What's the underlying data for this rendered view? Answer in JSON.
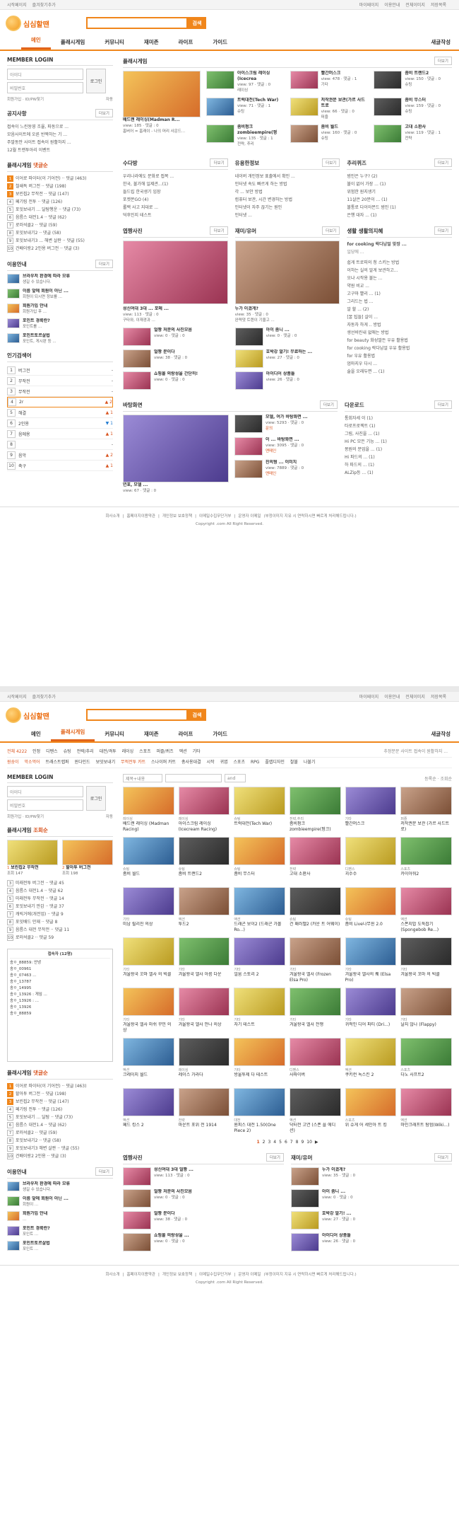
{
  "common": {
    "topbar_left": [
      "시작페이지",
      "즐겨찾기추가"
    ],
    "topbar_right": [
      "마이페이지",
      "이용안내",
      "전체이미지",
      "저장목록"
    ],
    "logo": "심심할땐",
    "search_btn": "검색",
    "gnb_right": "새글작성",
    "login_title": "MEMBER LOGIN",
    "id_placeholder": "아이디",
    "pw_placeholder": "비밀번호",
    "login_btn": "로그인",
    "signup": "회원가입 · ID/PW찾기",
    "auto": "자동",
    "more": "더보기",
    "footer_links": [
      "회사소개",
      "홈페이지이용약관",
      "개인정보 보호정책",
      "이메일수집무단거부",
      "운영자 이메일"
    ],
    "footer_note": "(부정이미지 지유 시 연락하시면 빠르게 처리해드립니다.)",
    "copyright": "Copyright .com All Right Reserved."
  },
  "shotA": {
    "gnb": [
      "메인",
      "플래시게임",
      "커뮤니티",
      "재미존",
      "라이프",
      "가이드"
    ],
    "notice_title": "공지사항",
    "notices": [
      "접속이 느린동영 조율, 파동으로 ...",
      "모음사이트에 오른 반짝하는 기 ...",
      "주말동안 사이트 접속이 원활하지 ...",
      "12월 트랜투아리 이벤트"
    ],
    "flash_list_title": "플래시게임",
    "flash_list_sub": "댓글순",
    "flash_list": [
      {
        "n": "1",
        "t": "이어로 파이터(이 기어전) ·· 댓글 (463)"
      },
      {
        "n": "2",
        "t": "철쇄독 버그전 ·· 댓글 (198)"
      },
      {
        "n": "3",
        "t": "보린칩2 무작전 ·· 댓글 (147)"
      },
      {
        "n": "4",
        "t": "페기링 전투 ·· 댓글 (126)"
      },
      {
        "n": "5",
        "t": "포잇보내기 ... 달탐행운 ·· 댓글 (73)"
      },
      {
        "n": "6",
        "t": "음름스 대전1.4 ·· 댓글 (62)"
      },
      {
        "n": "7",
        "t": "로러석클2 ·· 댓글 (59)"
      },
      {
        "n": "8",
        "t": "포잇보내기2 ·· 댓글 (58)"
      },
      {
        "n": "9",
        "t": "포잇보내기3 ... 해변 살판 ·· 댓글 (55)"
      },
      {
        "n": "10",
        "t": "건배이랑2 2인용 버그전 ·· 댓글 (3)"
      }
    ],
    "guide_title": "이용안내",
    "guides": [
      {
        "t": "브라우저 환경에 따라 모류",
        "s": "생길 수 있습니다."
      },
      {
        "t": "이름 앞에 회원이 아닌 ...",
        "s": "회원이 되시면 정보를 ..."
      },
      {
        "t": "회원가입 안내",
        "s": "회원가입 후 ..."
      },
      {
        "t": "포인트 경륙란?",
        "s": "포인트를 ..."
      },
      {
        "t": "포인트토르살법",
        "s": "포인트, 게시판 등 ..."
      }
    ],
    "ranking_title": "인기검색어",
    "ranking": [
      {
        "n": "1",
        "k": "버그전",
        "c": "-",
        "cls": ""
      },
      {
        "n": "2",
        "k": "무작전",
        "c": "-",
        "cls": ""
      },
      {
        "n": "3",
        "k": "무작전",
        "c": "-",
        "cls": ""
      },
      {
        "n": "4",
        "k": "2r",
        "c": "▲ 2",
        "cls": "up"
      },
      {
        "n": "5",
        "k": "해결",
        "c": "▲ 1",
        "cls": "up"
      },
      {
        "n": "6",
        "k": "2인용",
        "c": "▼ 1",
        "cls": "dn"
      },
      {
        "n": "7",
        "k": "음에용",
        "c": "▲ 1",
        "cls": "up"
      },
      {
        "n": "8",
        "k": "",
        "c": "-",
        "cls": ""
      },
      {
        "n": "9",
        "k": "음악",
        "c": "▲ 2",
        "cls": "up"
      },
      {
        "n": "10",
        "k": "축구",
        "c": "▲ 1",
        "cls": "up"
      }
    ],
    "flash_title": "플래시게임",
    "games": [
      {
        "t": "배드랜 레이싱(Madman R...",
        "v": "view: 185 · 댓글 : 0",
        "d": "홈버어 = 홈래이 - 나의 머리 사운드..."
      },
      {
        "t": "아이스크림 레이싱 (Icecrea",
        "v": "view: 97 · 댓글 : 0",
        "d": "레이싱"
      },
      {
        "t": "빨간머스크",
        "v": "view: 478 · 댓글 : 1",
        "d": "기타"
      },
      {
        "t": "좀비 트랜드2",
        "v": "view: 150 · 댓글 : 0",
        "d": "슈팅"
      },
      {
        "t": "트럭대전(Tech War)",
        "v": "view: 71 · 댓글 : 1",
        "d": "슈팅"
      },
      {
        "t": "저작권문 보관(가르 사드트로",
        "v": "view: 66 · 댓글 : 0",
        "d": "퍼즐"
      },
      {
        "t": "좀비 무스터",
        "v": "view: 159 · 댓글 : 0",
        "d": "슈팅"
      },
      {
        "t": "좀비펑크 zombieempire(펑",
        "v": "view: 135 · 댓글 : 1",
        "d": "전략, 추리"
      },
      {
        "t": "좀비 월드",
        "v": "view: 160 · 댓글 : 0",
        "d": "슈팅"
      },
      {
        "t": "고대 소환사",
        "v": "view: 119 · 댓글 : 1",
        "d": "전략"
      }
    ],
    "c1_title": "수다방",
    "c1": [
      {
        "t": "우리나라에도 문화로 접목 ..."
      },
      {
        "t": "한국, 불가해 일제관...(1)"
      },
      {
        "t": "들드립 한국생기 입장"
      },
      {
        "t": "포켓몬GO (4)"
      },
      {
        "t": "롤백 사고 지대로 ..."
      },
      {
        "t": "덕후인지 테스트"
      }
    ],
    "c2_title": "유용한정보",
    "c2": [
      {
        "t": "네이버 개인정보 표출에서 확인 ..."
      },
      {
        "t": "인터넷 속도 빠르게 하는 방법"
      },
      {
        "t": "각 ... 보안 방법"
      },
      {
        "t": "컴퓨터 보관, 시간 변경하는 방법"
      },
      {
        "t": "인터넷이 자주 끊기는 원인"
      },
      {
        "t": "인터넷 ..."
      }
    ],
    "c3_title": "추리퀴즈",
    "c3": [
      {
        "t": "범인은 누구? (2)"
      },
      {
        "t": "불이 없어 가장 ... (1)"
      },
      {
        "t": "위험한 원지생기"
      },
      {
        "t": "11살은 20분이 ... (1)"
      },
      {
        "t": "볼통로 다이아몬드 범인 (1)"
      },
      {
        "t": "은행 대자 ... (1)"
      }
    ],
    "p1_title": "엽짱사진",
    "p1_main": {
      "t": "성신여대 3대 ... 포메 ...",
      "v": "view: 113 · 댓글 : 0",
      "d": "구타와, 이재경과 ..."
    },
    "p1": [
      {
        "t": "얼짱 처분의 사진모음",
        "v": "view: 0 · 댓글 : 0"
      },
      {
        "t": "얼짱 분이다",
        "v": "view: 38 · 댓글 : 0"
      },
      {
        "t": "쇼핑몰 의랑성을 간단히!",
        "v": "view: 0 · 댓글 : 0"
      }
    ],
    "p2_title": "재미/유머",
    "p2_main": {
      "t": "누가 이겼게?",
      "v": "view: 35 · 댓글 : 0",
      "d": "완력댓 트렌이 기울고 ..."
    },
    "p2": [
      {
        "t": "아이 좀니 ...",
        "v": "view: 0 · 댓글 : 0"
      },
      {
        "t": "호박강 알기! 무료하는 ...",
        "v": "view: 27 · 댓글 : 0"
      },
      {
        "t": "아이디어 상품들",
        "v": "view: 26 · 댓글 : 0"
      }
    ],
    "p3_title": "생활 생활의지혜",
    "p3_lead": "for cooking 락다납얼 맞장 ...",
    "p3_desc": "일당에 ...",
    "p3": [
      "쉽게 트로피의 청 스키는 방법",
      "이하는 실의 알게 보관하고...",
      "오냐 시작용 불는 ...",
      "약원 비교 ...",
      "고구마 빨리 ... (1)",
      "그리드는 법 ...",
      "알 할 ... (2)",
      "[꿀 팁들] 살이 ...",
      "자동차 하게 .. 방법",
      "생선비린내 없애는 방법",
      "for beauty 화성말든 우유 활용법",
      "for cooking 락다납얼 우유 활용법",
      "for 우유 활용법",
      "엄마지우 다시 ...",
      "술을 오래두면 ... (1)"
    ],
    "v_title": "바탕화면",
    "v_main": {
      "t": "연표, 모델 ...",
      "v": "view: 67 · 댓글 : 0"
    },
    "v": [
      {
        "t": "모델, 여가 바탕화면 ...",
        "v": "view: 5293 · 댓글 : 0",
        "a": "문의"
      },
      {
        "t": "이 ... 바탕화면 ...",
        "v": "view: 3095 · 댓글 : 0",
        "a": "맨메인"
      },
      {
        "t": "친의형 ... 이미지",
        "v": "view: 7889 · 댓글 : 0",
        "a": "맨메인"
      }
    ],
    "dl_title": "다운로드",
    "dl": [
      "통회자세 이 (1)",
      "타로프로젝트 (1)",
      "그림, 사진을 ... (1)",
      "Hi PC 모든 기능 ... (1)",
      "몽원의 분업을 ... (1)",
      "Hi 파드의 ... (1)",
      "하 파드의 ... (1)",
      "ALZip등 ... (1)"
    ]
  },
  "shotB": {
    "gnb": [
      "메인",
      "플래시게임",
      "커뮤니티",
      "재미존",
      "라이프",
      "가이드"
    ],
    "cat_all": "전체 4222",
    "cats1": [
      "인정",
      "디펜스",
      "슈팅",
      "전략/추리",
      "대전/격투",
      "레이싱",
      "스포츠",
      "퍼즐/퀴즈",
      "액션",
      "기타"
    ],
    "cat_hint": "추정분문 사이트 접속이 원활하지 ...",
    "cats2": [
      "원숭이",
      "막소먹어",
      "트래스트랩퍼",
      "윈다인드",
      "보잇보내기",
      "무적전투 카트",
      "스나이퍼 카트",
      "총사용대결",
      "시작",
      "귀엽",
      "스포츠",
      "RPG",
      "플랩디자인",
      "찰불",
      "나불기"
    ],
    "filter_sel": "제목+내용",
    "filter_btn": "and",
    "filter_right": "등록순 · 조회순",
    "ranked_title": "플래시게임",
    "ranked_sub": "조회순",
    "ranked_top": [
      {
        "n": "1",
        "t": "보린칩2 무작전",
        "c": "조회 147"
      },
      {
        "n": "2",
        "t": "할아투 버그전",
        "c": "조회 198"
      }
    ],
    "ranked_list": [
      {
        "n": "3",
        "t": "미래전투 버그전 ·· 댓글 45"
      },
      {
        "n": "4",
        "t": "음름스 대전1.4 ·· 댓글 62"
      },
      {
        "n": "5",
        "t": "미래전투 무작전 ·· 댓글 14"
      },
      {
        "n": "6",
        "t": "포잇보내기 만감 ·· 댓글 37"
      },
      {
        "n": "7",
        "t": "캐릭거에(개전업) ·· 댓글 9"
      },
      {
        "n": "8",
        "t": "포잇배드 만재 ·· 댓글 8"
      },
      {
        "n": "9",
        "t": "음름스 대전 무작전 ·· 댓글 11"
      },
      {
        "n": "10",
        "t": "로러석클2 ·· 댓글 59"
      }
    ],
    "chat_title": "접속자 (12명)",
    "chat": [
      "송ㅇ_88859: 안녕",
      "송ㅇ_00961",
      "송ㅇ_07463 ...",
      "송ㅇ_13787",
      "송ㅇ_14995",
      "송ㅇ_13926 : 게임 ...",
      "송ㅇ_13926 : ...",
      "송ㅇ_13926",
      "송ㅇ_88859"
    ],
    "list2_title": "플래시게임",
    "list2_sub": "댓글순",
    "list2": [
      {
        "n": "1",
        "t": "이어로 파이터(이 기어전) ·· 댓글 (463)"
      },
      {
        "n": "2",
        "t": "할아투 버그전 ·· 댓글 (198)"
      },
      {
        "n": "3",
        "t": "보린칩2 무작전 ·· 댓글 (147)"
      },
      {
        "n": "4",
        "t": "페기링 전투 ·· 댓글 (126)"
      },
      {
        "n": "5",
        "t": "포잇보내기 ... 달탐 ·· 댓글 (73)"
      },
      {
        "n": "6",
        "t": "음름스 대전1.4 ·· 댓글 (62)"
      },
      {
        "n": "7",
        "t": "로러석클2 ·· 댓글 (59)"
      },
      {
        "n": "8",
        "t": "포잇보내기2 ·· 댓글 (58)"
      },
      {
        "n": "9",
        "t": "포잇보내기3 해변 살판 ·· 댓글 (55)"
      },
      {
        "n": "10",
        "t": "건배이랑2 2인용 ·· 댓글 (3)"
      }
    ],
    "guide_title": "이용안내",
    "guides": [
      {
        "t": "브라우저 환경에 따라 모류",
        "s": "생길 수 있습니다."
      },
      {
        "t": "이름 앞에 회원이 아닌 ...",
        "s": "회원이 ..."
      },
      {
        "t": "회원가입 안내",
        "s": "..."
      },
      {
        "t": "포인트 경륙란?",
        "s": "포인트 ..."
      },
      {
        "t": "포인트토르살법",
        "s": "포인트 ..."
      }
    ],
    "cells": [
      {
        "n": "배드랜 레이싱 (Madman Racing)",
        "k": "레이싱"
      },
      {
        "n": "아이스크림 레이싱 (Icecream Racing)",
        "k": "레이싱"
      },
      {
        "n": "트럭대전(Tech War)",
        "k": "슈팅"
      },
      {
        "n": "좀비펑크 zombieempire(펑크)",
        "k": "전략,추리"
      },
      {
        "n": "빨간머스크",
        "k": "기타"
      },
      {
        "n": "저작권문 보관 (가르 사드트로)",
        "k": "퍼즐"
      },
      {
        "n": "좀비 월드",
        "k": "슈팅"
      },
      {
        "n": "좀비 트랜드2",
        "k": "슈팅"
      },
      {
        "n": "좀비 무스터",
        "k": "슈팅"
      },
      {
        "n": "고대 소환사",
        "k": "전략"
      },
      {
        "n": "괴수수",
        "k": "디펜스"
      },
      {
        "n": "카이아워2",
        "k": "스포츠"
      },
      {
        "n": "미남 릴리진 의상",
        "k": "기타"
      },
      {
        "n": "투드2",
        "k": "액션"
      },
      {
        "n": "드래곤 보이2 (드래곤 가볼 Ro...)",
        "k": "액션"
      },
      {
        "n": "건 패러밸2 (카운 트 어웨이)",
        "k": "슈팅"
      },
      {
        "n": "좀비 Live나무윈 2.0",
        "k": "슈팅"
      },
      {
        "n": "스폰지밥 도둑잡기 (Spongebob Re...)",
        "k": "액션"
      },
      {
        "n": "겨울왕국 꼬마 엘사 의 빅클",
        "k": "기타"
      },
      {
        "n": "겨울왕국 엘사 아름 다운",
        "k": "기타"
      },
      {
        "n": "얼움 스토리 2",
        "k": "기타"
      },
      {
        "n": "겨울왕국 엘사 (Frozen Elsa Pro)",
        "k": "기타"
      },
      {
        "n": "겨울왕국 엘사의 퀘 (Elsa Pro)",
        "k": "기타"
      },
      {
        "n": "겨울왕국 꼬마 의 빅클",
        "k": "기타"
      },
      {
        "n": "겨울왕국 엘사 마쉬 꾸민 의상",
        "k": "기타"
      },
      {
        "n": "겨울왕국 엘사 안나 의상",
        "k": "기타"
      },
      {
        "n": "자기 테스트",
        "k": "기타"
      },
      {
        "n": "겨울왕국 엘사 전쟁",
        "k": "기타"
      },
      {
        "n": "귀적인 디어 파티 (Dri...)",
        "k": "기타"
      },
      {
        "n": "날지 않나 (Flappy)",
        "k": "기타"
      },
      {
        "n": "크레이지 월드",
        "k": "액션"
      },
      {
        "n": "레이스 가라다",
        "k": "레이싱"
      },
      {
        "n": "방울투제 다 테스트",
        "k": "기타"
      },
      {
        "n": "사파이버",
        "k": "디펜스"
      },
      {
        "n": "쿠키런 녹스킨 2",
        "k": "액션"
      },
      {
        "n": "다노 사프트2",
        "k": "스포츠"
      },
      {
        "n": "페드 킹스 2",
        "k": "액션"
      },
      {
        "n": "마운트 포위 전 1914",
        "k": "전략"
      },
      {
        "n": "원피스 대전 1.50(One Piece 2)",
        "k": "대전"
      },
      {
        "n": "닥터전 고연 (스폰 플 에디션)",
        "k": "액션"
      },
      {
        "n": "위 슈게 어 세인아 트 킹",
        "k": "스포츠"
      },
      {
        "n": "마인크래프트 탐험(Wiki...)",
        "k": "액션"
      }
    ],
    "pager": [
      "1",
      "2",
      "3",
      "4",
      "5",
      "6",
      "7",
      "8",
      "9",
      "10"
    ],
    "pager_next": "▶",
    "b1_title": "엽짱사진",
    "b1": [
      {
        "t": "성신여대 3대 얼짱 ...",
        "v": "view: 113 · 댓글 : 0"
      },
      {
        "t": "얼짱 처분의 사진모음",
        "v": "view: 0 · 댓글 : 0"
      },
      {
        "t": "얼짱 분이다",
        "v": "view: 38 · 댓글 : 0"
      },
      {
        "t": "쇼핑몰 의랑성을 ...",
        "v": "view: 0 · 댓글 : 0"
      }
    ],
    "b2_title": "재미/유머",
    "b2": [
      {
        "t": "누가 이겼게?",
        "v": "view: 35 · 댓글 : 0"
      },
      {
        "t": "아이 좀니 ...",
        "v": "view: 0 · 댓글 : 0"
      },
      {
        "t": "호박강 알기! ...",
        "v": "view: 27 · 댓글 : 0"
      },
      {
        "t": "아이디어 상품들",
        "v": "view: 26 · 댓글 : 0"
      }
    ]
  }
}
